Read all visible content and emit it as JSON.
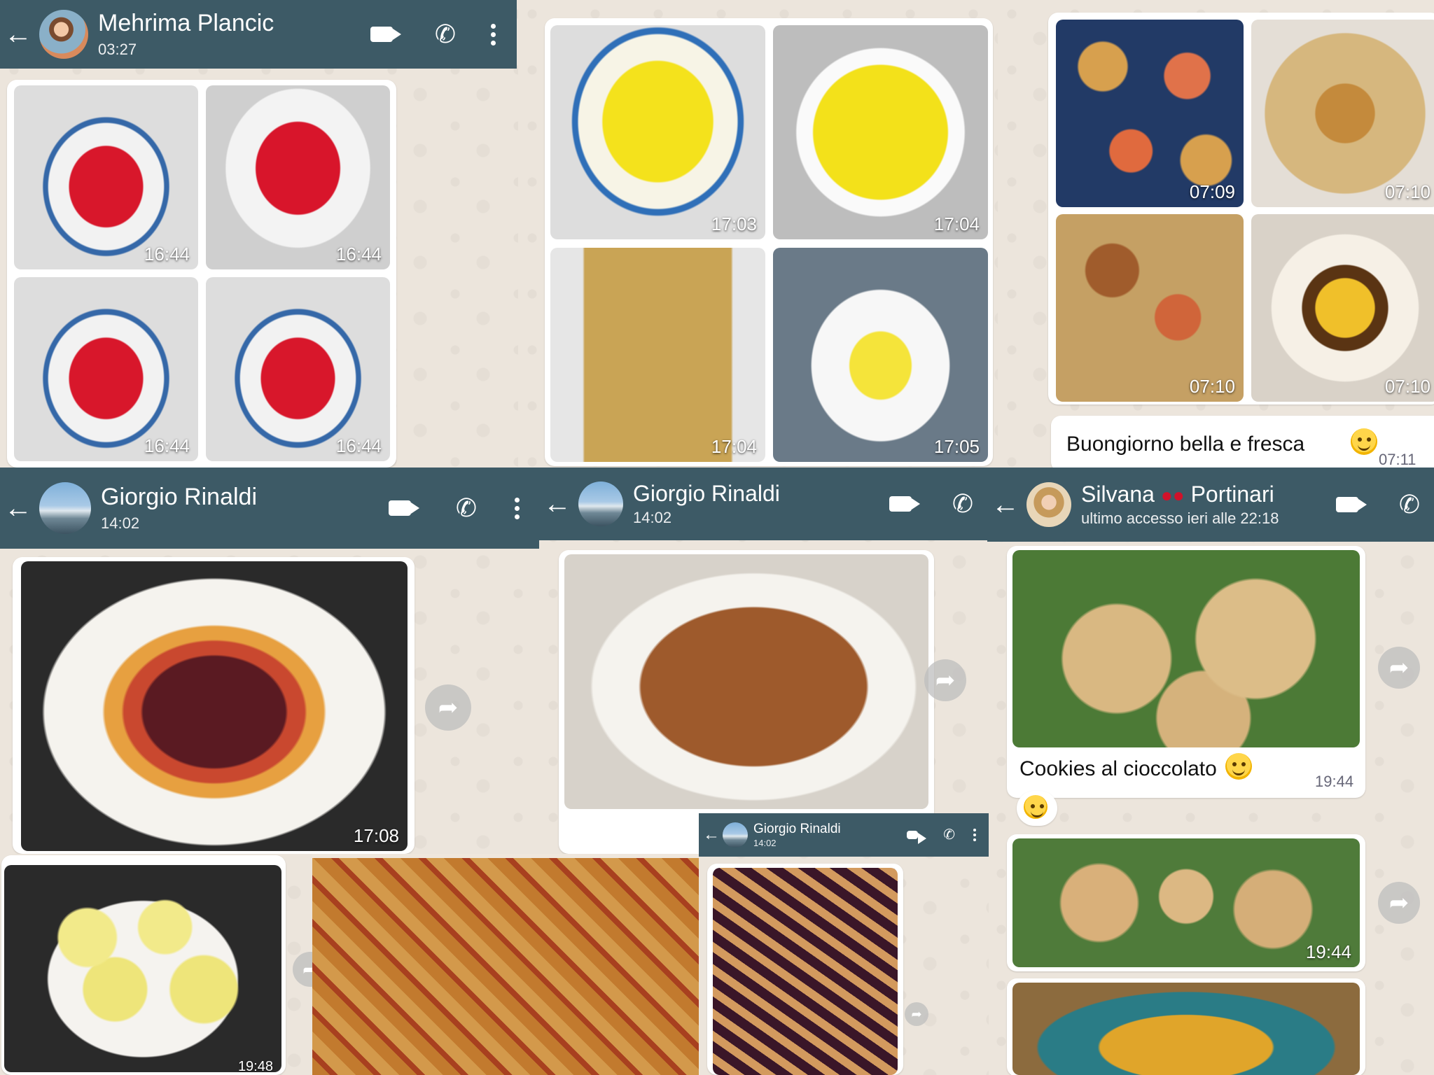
{
  "panels": {
    "mehrima": {
      "contact": "Mehrima Plancic",
      "status": "03:27",
      "photo_times": [
        "16:44",
        "16:44",
        "16:44",
        "16:44"
      ]
    },
    "yellow": {
      "photo_times": [
        "17:03",
        "17:04",
        "17:04",
        "17:05"
      ]
    },
    "pastries": {
      "photo_times": [
        "07:09",
        "07:10",
        "07:10",
        "07:10"
      ],
      "message": "Buongiorno bella e fresca",
      "message_time": "07:11"
    },
    "giorgio_tart": {
      "contact": "Giorgio Rinaldi",
      "status": "14:02",
      "photo_time": "17:08"
    },
    "giorgio_choco": {
      "contact": "Giorgio Rinaldi",
      "status": "14:02"
    },
    "silvana": {
      "contact_first": "Silvana",
      "contact_last": "Portinari",
      "status": "ultimo accesso ieri alle 22:18",
      "caption": "Cookies al cioccolato",
      "caption_time": "19:44",
      "photo2_time": "19:44"
    },
    "giorgio_small": {
      "contact": "Giorgio Rinaldi",
      "status": "14:02"
    },
    "yellow_minis": {
      "photo_time": "19:48"
    }
  },
  "icons": {
    "back": "arrow-left",
    "video": "video-camera",
    "call": "phone",
    "menu": "vertical-dots",
    "forward": "share-arrow",
    "cherry": "cherry-emoji",
    "smile": "smiling-face-emoji"
  },
  "colors": {
    "header": "#3d5a66",
    "chat_bg": "#ece5dc",
    "bubble": "#ffffff"
  }
}
